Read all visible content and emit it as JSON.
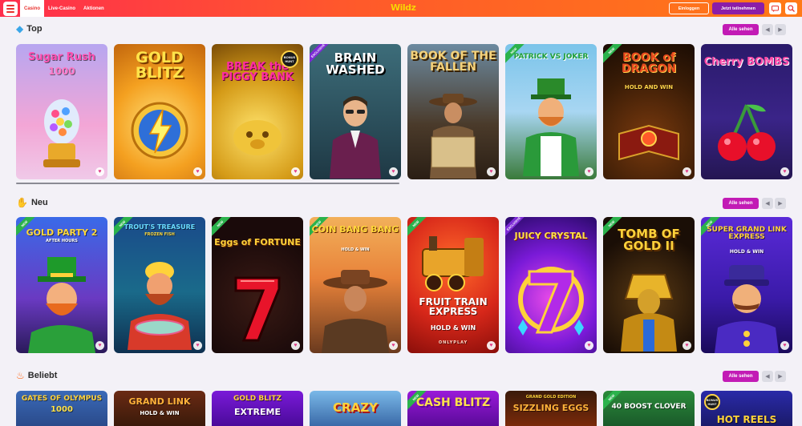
{
  "header": {
    "tabs": [
      {
        "label": "Casino",
        "active": true
      },
      {
        "label": "Live-Casino",
        "active": false
      },
      {
        "label": "Aktionen",
        "active": false
      }
    ],
    "logo": "Wildz",
    "login_label": "Einloggen",
    "join_label": "Jetzt teilnehmen",
    "icons": [
      "menu-icon",
      "chat-icon",
      "search-icon"
    ]
  },
  "sections": [
    {
      "title": "Top",
      "icon": "diamond-icon",
      "see_all": "Alle sehen",
      "games": [
        {
          "title": "Sugar Rush",
          "subtitle": "1000",
          "badge": ""
        },
        {
          "title": "GOLD BLITZ",
          "subtitle": "",
          "badge": ""
        },
        {
          "title": "BREAK the PIGGY BANK",
          "subtitle": "BONUS HUNT",
          "badge": ""
        },
        {
          "title": "BRAIN WASHED",
          "subtitle": "",
          "badge": "EXCLUSIVE"
        },
        {
          "title": "BOOK OF THE FALLEN",
          "subtitle": "",
          "badge": ""
        },
        {
          "title": "PATRICK VS JOKER",
          "subtitle": "",
          "badge": "NEW"
        },
        {
          "title": "BOOK of DRAGON",
          "subtitle": "HOLD AND WIN",
          "badge": "NEW"
        },
        {
          "title": "Cherry BOMBS",
          "subtitle": "",
          "badge": ""
        }
      ]
    },
    {
      "title": "Neu",
      "icon": "hand-icon",
      "see_all": "Alle sehen",
      "games": [
        {
          "title": "GOLD PARTY 2",
          "subtitle": "AFTER HOURS",
          "badge": "NEW"
        },
        {
          "title": "TROUT'S TREASURE",
          "subtitle": "FROZEN FISH",
          "badge": "NEW"
        },
        {
          "title": "Eggs of FORTUNE",
          "subtitle": "",
          "badge": "NEW"
        },
        {
          "title": "COIN BANG BANG",
          "subtitle": "HOLD & WIN",
          "badge": "NEW"
        },
        {
          "title": "FRUIT TRAIN EXPRESS",
          "subtitle": "HOLD & WIN",
          "badge": "NEW"
        },
        {
          "title": "JUICY CRYSTAL",
          "subtitle": "",
          "badge": "EXCLUSIVE"
        },
        {
          "title": "TOMB OF GOLD II",
          "subtitle": "",
          "badge": "NEW"
        },
        {
          "title": "SUPER GRAND LINK EXPRESS",
          "subtitle": "HOLD & WIN",
          "badge": "NEW"
        }
      ]
    },
    {
      "title": "Beliebt",
      "icon": "fire-icon",
      "see_all": "Alle sehen",
      "games": [
        {
          "title": "GATES OF OLYMPUS",
          "subtitle": "1000",
          "badge": ""
        },
        {
          "title": "GRAND LINK",
          "subtitle": "HOLD & WIN",
          "badge": ""
        },
        {
          "title": "GOLD BLITZ",
          "subtitle": "EXTREME",
          "badge": ""
        },
        {
          "title": "CRAZY",
          "subtitle": "",
          "badge": ""
        },
        {
          "title": "CASH BLITZ",
          "subtitle": "",
          "badge": "NEW"
        },
        {
          "title": "SIZZLING EGGS",
          "subtitle": "GRAND GOLD EDITION",
          "badge": ""
        },
        {
          "title": "40 BOOST CLOVER",
          "subtitle": "",
          "badge": "NEW"
        },
        {
          "title": "HOT REELS",
          "subtitle": "BONUS HUNT",
          "badge": ""
        }
      ]
    }
  ],
  "footer_provider": "ONLYPLAY"
}
